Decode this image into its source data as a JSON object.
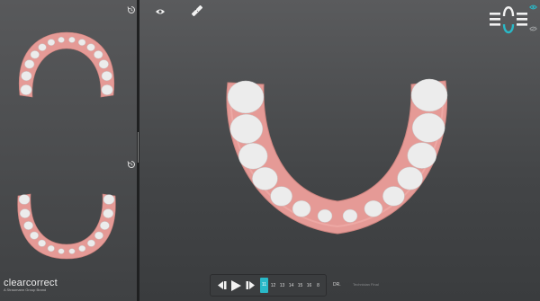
{
  "brand": {
    "name": "clearcorrect",
    "tagline": "A Straumann Group Brand"
  },
  "toolbar": {
    "view_icon": "eye-icon",
    "measure_icon": "ruler-icon"
  },
  "left_panel": {
    "upper_view": {
      "reset_icon": "reset-view-icon"
    },
    "lower_view": {
      "reset_icon": "reset-view-icon"
    }
  },
  "arch_toggle": {
    "accent": "#29b9c8",
    "upper_eye": "eye-icon",
    "lower_eye": "eye-off-icon"
  },
  "player": {
    "prev_icon": "step-back-icon",
    "play_icon": "play-icon",
    "next_icon": "step-forward-icon",
    "steps": [
      "11",
      "12",
      "13",
      "14",
      "15",
      "16",
      "8"
    ],
    "active_step": "11",
    "dr_label": "DR.",
    "tech_label": "Technician Final"
  },
  "colors": {
    "accent": "#29b9c8",
    "gum": "#e59a96",
    "tooth": "#ececec"
  }
}
